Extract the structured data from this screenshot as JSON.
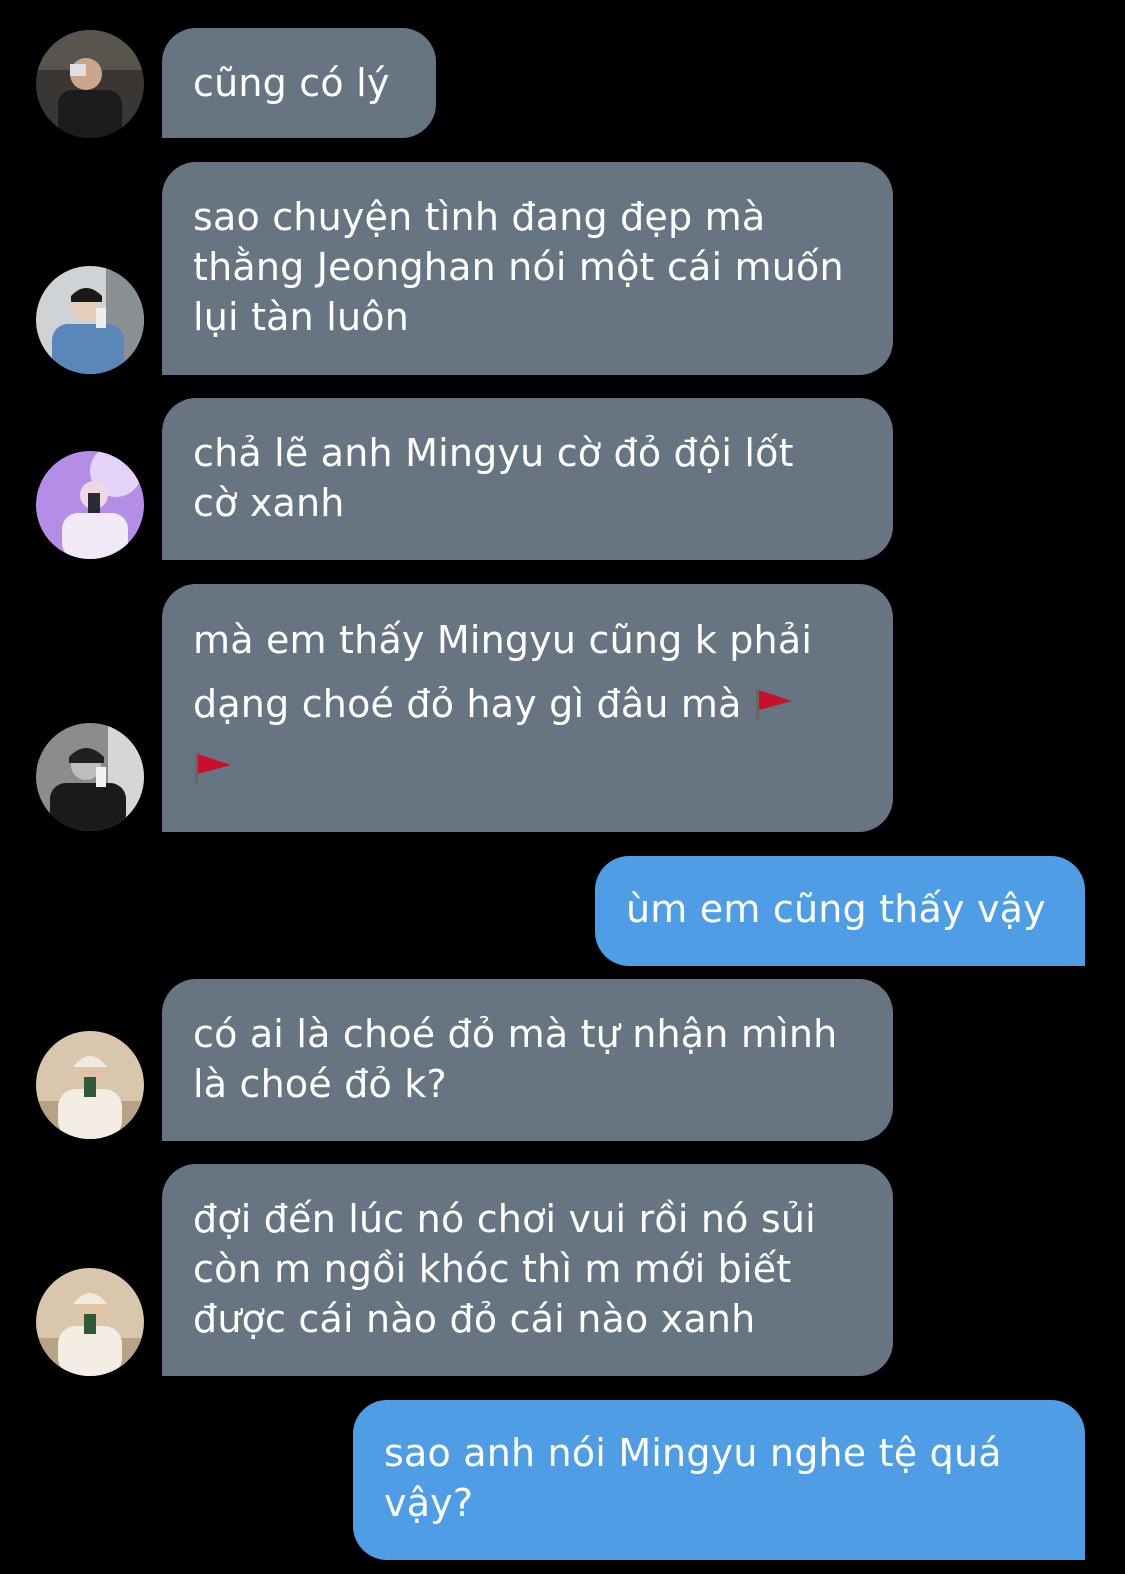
{
  "thread": {
    "messages": [
      {
        "side": "incoming",
        "avatar": "avatar-1",
        "lines": [
          "cũng có lý"
        ]
      },
      {
        "side": "incoming",
        "avatar": "avatar-2",
        "lines": [
          "sao chuyện tình đang đẹp mà",
          "thằng Jeonghan nói một cái muốn",
          "lụi tàn luôn"
        ]
      },
      {
        "side": "incoming",
        "avatar": "avatar-3",
        "lines": [
          "chả lẽ anh Mingyu cờ đỏ đội lốt",
          "cờ xanh"
        ]
      },
      {
        "side": "incoming",
        "avatar": "avatar-4",
        "lines": [
          "mà em thấy Mingyu cũng k phải",
          "dạng choé đỏ hay gì đâu mà"
        ],
        "trailing_icons": [
          "red-flag-icon",
          "red-flag-icon"
        ]
      },
      {
        "side": "outgoing",
        "lines": [
          "ùm em cũng thấy vậy"
        ]
      },
      {
        "side": "incoming",
        "avatar": "avatar-5",
        "lines": [
          "có ai là choé đỏ mà tự nhận mình",
          "là choé đỏ k?"
        ]
      },
      {
        "side": "incoming",
        "avatar": "avatar-5",
        "lines": [
          "đợi đến lúc nó chơi vui rồi nó sủi",
          "còn m ngồi khóc thì m mới biết",
          "được cái nào đỏ cái nào xanh"
        ]
      },
      {
        "side": "outgoing",
        "lines": [
          "sao anh nói Mingyu nghe tệ quá",
          "vậy?"
        ]
      }
    ]
  },
  "colors": {
    "background": "#000000",
    "incoming_bubble": "#677481",
    "outgoing_bubble": "#4e9de5",
    "text": "#ffffff",
    "flag": "#c8102e"
  }
}
